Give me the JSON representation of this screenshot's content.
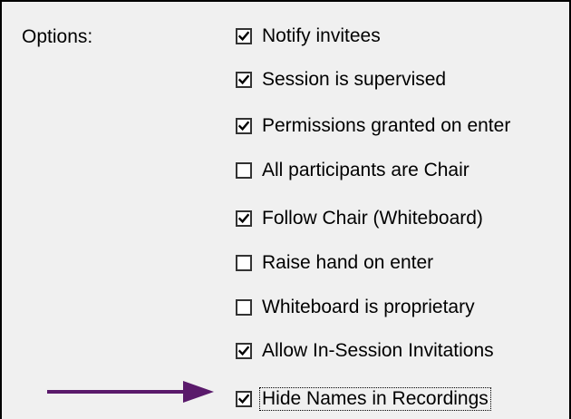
{
  "panel": {
    "options_label": "Options:"
  },
  "options": [
    {
      "label": "Notify invitees",
      "checked": true
    },
    {
      "label": "Session is supervised",
      "checked": true
    },
    {
      "label": "Permissions granted on enter",
      "checked": true
    },
    {
      "label": "All participants are Chair",
      "checked": false
    },
    {
      "label": "Follow Chair (Whiteboard)",
      "checked": true
    },
    {
      "label": "Raise hand on enter",
      "checked": false
    },
    {
      "label": "Whiteboard is proprietary",
      "checked": false
    },
    {
      "label": "Allow In-Session Invitations",
      "checked": true
    },
    {
      "label": "Hide Names in Recordings",
      "checked": true,
      "focused": true
    }
  ],
  "annotation": {
    "arrow_color": "#5a1a6b",
    "arrow_icon": "arrow-right-icon"
  }
}
